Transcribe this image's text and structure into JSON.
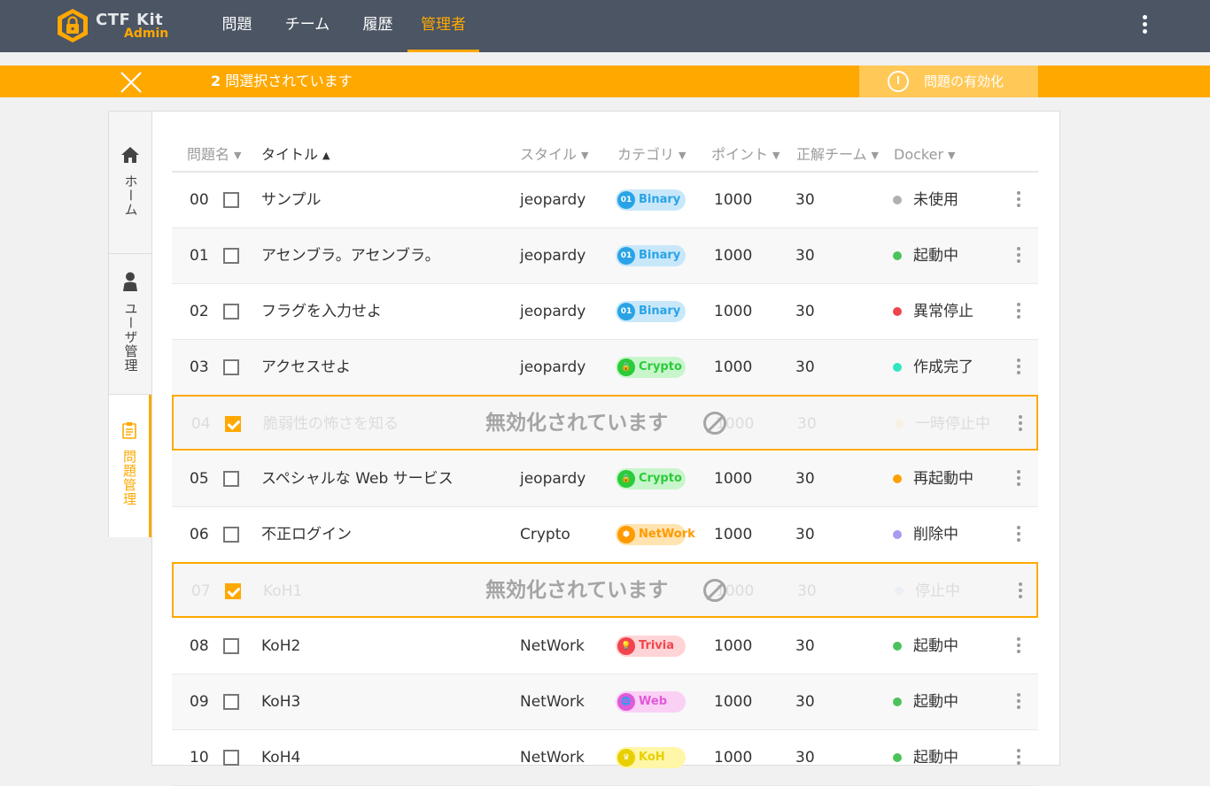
{
  "app": {
    "logo_title": "CTF Kit",
    "logo_sub": "Admin"
  },
  "nav": [
    {
      "label": "問題",
      "active": false
    },
    {
      "label": "チーム",
      "active": false
    },
    {
      "label": "履歴",
      "active": false
    },
    {
      "label": "管理者",
      "active": true
    }
  ],
  "selection": {
    "count": "2",
    "text": "問選択されています",
    "enable_label": "問題の有効化"
  },
  "sidetabs": [
    {
      "label": "ホーム",
      "icon": "home-icon",
      "active": false
    },
    {
      "label": "ユーザ管理",
      "icon": "user-icon",
      "active": false
    },
    {
      "label": "問題管理",
      "icon": "clipboard-icon",
      "active": true
    }
  ],
  "table": {
    "headers": {
      "name": "問題名",
      "title": "タイトル",
      "style": "スタイル",
      "category": "カテゴリ",
      "points": "ポイント",
      "solved": "正解チーム",
      "docker": "Docker"
    },
    "disabled_label": "無効化されています",
    "rows": [
      {
        "no": "00",
        "title": "サンプル",
        "style": "jeopardy",
        "category": "Binary",
        "points": "1000",
        "solved": "30",
        "status": "未使用",
        "status_color": "#b0b0b0",
        "checked": false,
        "disabled": false
      },
      {
        "no": "01",
        "title": "アセンブラ。アセンブラ。",
        "style": "jeopardy",
        "category": "Binary",
        "points": "1000",
        "solved": "30",
        "status": "起動中",
        "status_color": "#4cc35a",
        "checked": false,
        "disabled": false
      },
      {
        "no": "02",
        "title": "フラグを入力せよ",
        "style": "jeopardy",
        "category": "Binary",
        "points": "1000",
        "solved": "30",
        "status": "異常停止",
        "status_color": "#f0454d",
        "checked": false,
        "disabled": false
      },
      {
        "no": "03",
        "title": "アクセスせよ",
        "style": "jeopardy",
        "category": "Crypto",
        "points": "1000",
        "solved": "30",
        "status": "作成完了",
        "status_color": "#30e5c0",
        "checked": false,
        "disabled": false
      },
      {
        "no": "04",
        "title": "脆弱性の怖さを知る",
        "style": "",
        "category": "",
        "points": "1000",
        "solved": "30",
        "status": "一時停止中",
        "status_color": "#f2e8b0",
        "checked": true,
        "disabled": true
      },
      {
        "no": "05",
        "title": "スペシャルな Web サービス",
        "style": "jeopardy",
        "category": "Crypto",
        "points": "1000",
        "solved": "30",
        "status": "再起動中",
        "status_color": "#ffa000",
        "checked": false,
        "disabled": false
      },
      {
        "no": "06",
        "title": "不正ログイン",
        "style": "Crypto",
        "category": "NetWork",
        "points": "1000",
        "solved": "30",
        "status": "削除中",
        "status_color": "#a79af0",
        "checked": false,
        "disabled": false
      },
      {
        "no": "07",
        "title": "KoH1",
        "style": "",
        "category": "",
        "points": "1000",
        "solved": "30",
        "status": "停止中",
        "status_color": "#cfe0f2",
        "checked": true,
        "disabled": true
      },
      {
        "no": "08",
        "title": "KoH2",
        "style": "NetWork",
        "category": "Trivia",
        "points": "1000",
        "solved": "30",
        "status": "起動中",
        "status_color": "#4cc35a",
        "checked": false,
        "disabled": false
      },
      {
        "no": "09",
        "title": "KoH3",
        "style": "NetWork",
        "category": "Web",
        "points": "1000",
        "solved": "30",
        "status": "起動中",
        "status_color": "#4cc35a",
        "checked": false,
        "disabled": false
      },
      {
        "no": "10",
        "title": "KoH4",
        "style": "NetWork",
        "category": "KoH",
        "points": "1000",
        "solved": "30",
        "status": "起動中",
        "status_color": "#4cc35a",
        "checked": false,
        "disabled": false
      }
    ]
  },
  "category_styles": {
    "Binary": {
      "bg": "#c8e8fa",
      "fg": "#2aa3e6",
      "icon_text": "01"
    },
    "Crypto": {
      "bg": "#c9f5cc",
      "fg": "#2bcb3a",
      "icon_text": "🔒"
    },
    "NetWork": {
      "bg": "#ffe3b0",
      "fg": "#ff9a00",
      "icon_text": "⬢"
    },
    "Trivia": {
      "bg": "#ffd4d6",
      "fg": "#f0454d",
      "icon_text": "💡"
    },
    "Web": {
      "bg": "#fbd0f5",
      "fg": "#e05ad8",
      "icon_text": "🌐"
    },
    "KoH": {
      "bg": "#fff6a8",
      "fg": "#e8d000",
      "icon_text": "♛"
    }
  }
}
